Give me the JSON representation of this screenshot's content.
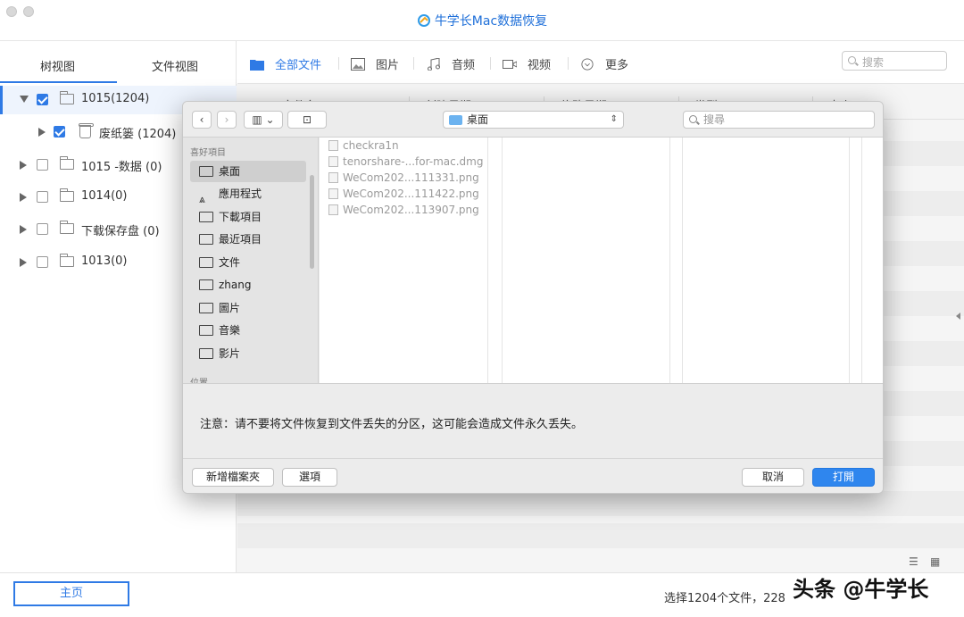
{
  "app": {
    "title": "牛学长Mac数据恢复"
  },
  "sidebar": {
    "tabs": [
      "树视图",
      "文件视图"
    ],
    "tree": [
      {
        "label": "1015(1204)",
        "checked": true,
        "expanded": true,
        "level": 0
      },
      {
        "label": "废纸篓 (1204)",
        "checked": true,
        "expanded": false,
        "level": 1
      },
      {
        "label": "1015 -数据 (0)",
        "checked": false,
        "expanded": false,
        "level": 0
      },
      {
        "label": "1014(0)",
        "checked": false,
        "expanded": false,
        "level": 0
      },
      {
        "label": "下载保存盘 (0)",
        "checked": false,
        "expanded": false,
        "level": 0
      },
      {
        "label": "1013(0)",
        "checked": false,
        "expanded": false,
        "level": 0
      }
    ]
  },
  "toolbar": {
    "filters": [
      "全部文件",
      "图片",
      "音频",
      "视频",
      "更多"
    ],
    "search_placeholder": "搜索"
  },
  "table": {
    "headers": [
      "文件名",
      "创建日期",
      "修改日期",
      "类型",
      "大小"
    ]
  },
  "bottom": {
    "home_label": "主页",
    "status": "选择1204个文件，228"
  },
  "dialog": {
    "location": "桌面",
    "search_placeholder": "搜尋",
    "sidebar_sections": [
      "喜好項目",
      "位置"
    ],
    "favorites": [
      "桌面",
      "應用程式",
      "下載項目",
      "最近項目",
      "文件",
      "zhang",
      "圖片",
      "音樂",
      "影片"
    ],
    "files": [
      "checkra1n",
      "tenorshare-...for-mac.dmg",
      "WeCom202...111331.png",
      "WeCom202...111422.png",
      "WeCom202...113907.png"
    ],
    "notice": "注意：请不要将文件恢复到文件丢失的分区，这可能会造成文件永久丢失。",
    "buttons": {
      "new_folder": "新增檔案夾",
      "options": "選項",
      "cancel": "取消",
      "open": "打開"
    }
  },
  "watermark": "头条 @牛学长"
}
